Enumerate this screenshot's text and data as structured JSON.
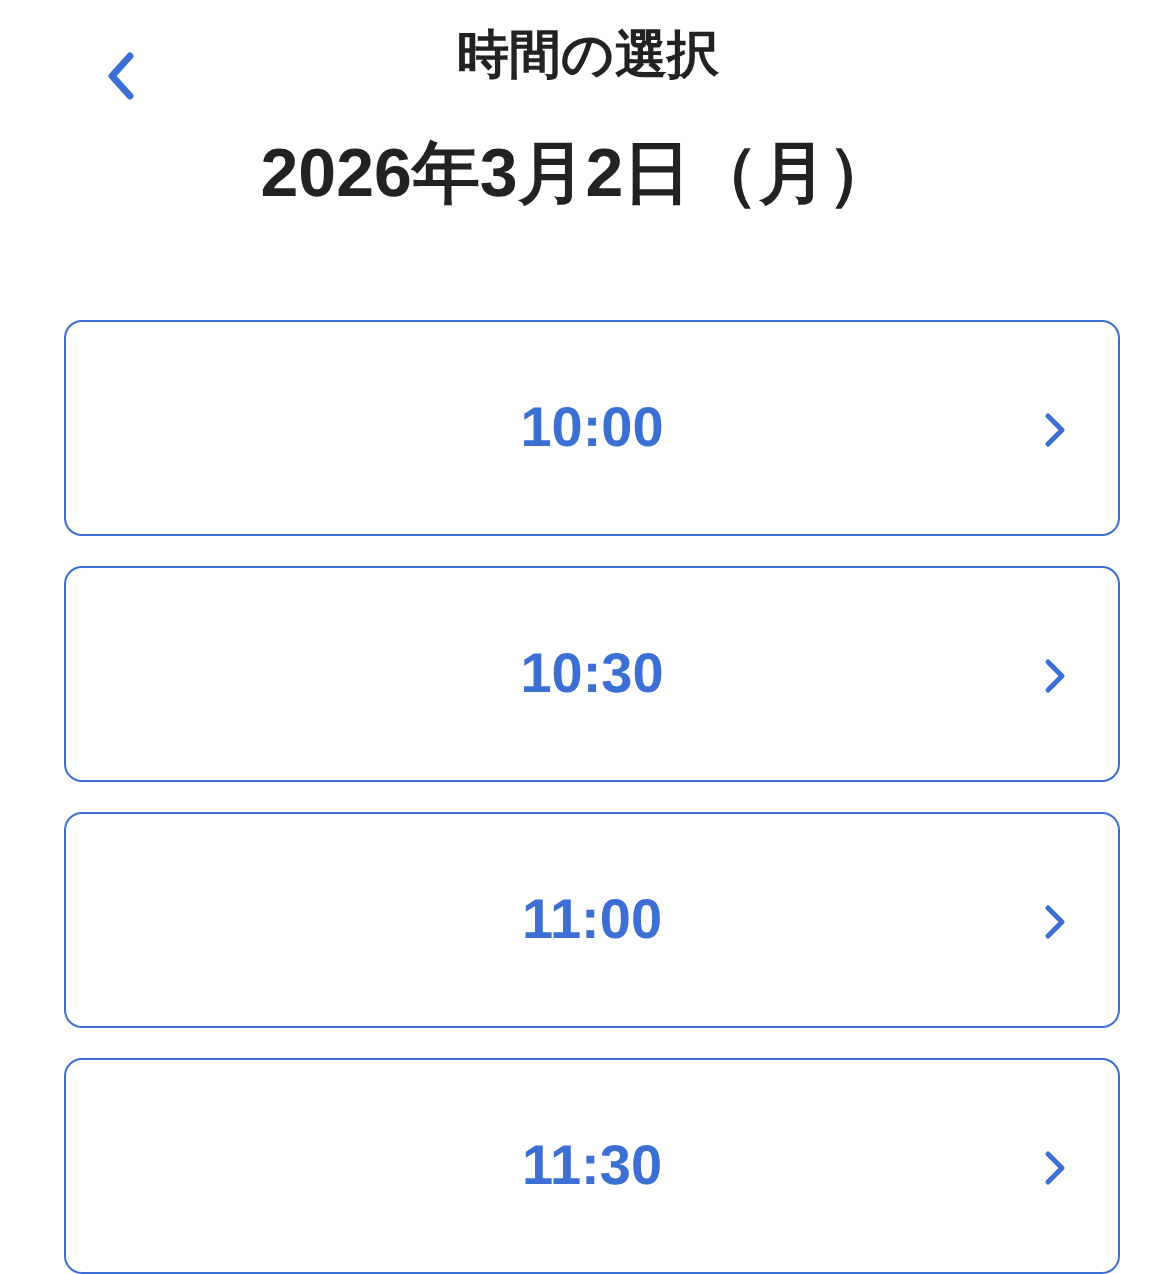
{
  "header": {
    "title": "時間の選択"
  },
  "date": "2026年3月2日（月）",
  "time_slots": [
    {
      "time": "10:00"
    },
    {
      "time": "10:30"
    },
    {
      "time": "11:00"
    },
    {
      "time": "11:30"
    }
  ]
}
